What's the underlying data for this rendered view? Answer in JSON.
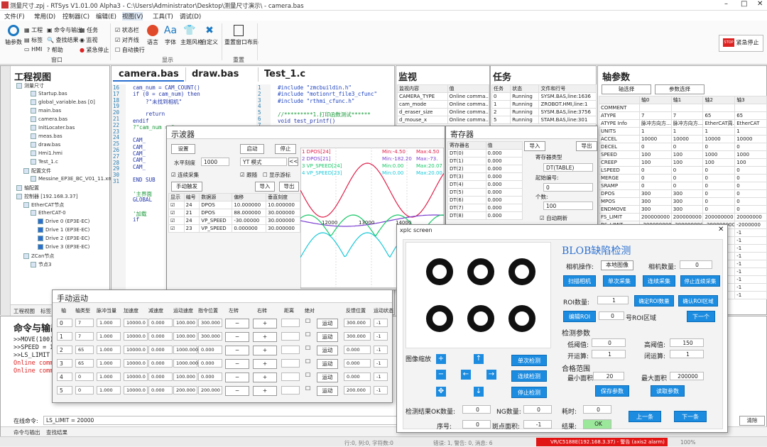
{
  "app": {
    "title": "测量尺寸.zpj - RTSys V1.01.00 Alpha3 - C:\\Users\\Administrator\\Desktop\\测量尺寸演示\\ - camera.bas"
  },
  "menu": [
    "文件(F)",
    "常用(D)",
    "控制器(C)",
    "编辑(E)",
    "视图(V)",
    "工具(T)",
    "调试(D)"
  ],
  "ribbon": {
    "axis_param": "轴参数",
    "project": "工程",
    "label": "标签",
    "hmi": "HMI",
    "cmd_output": "命令与输出",
    "find_result": "查找结果",
    "help": "帮助",
    "task": "任务",
    "watch": "监视",
    "estop_small": "紧急停止",
    "status_bar": "状态栏",
    "align_bar": "对齐线",
    "auto_wrap": "自动换行",
    "language": "语言",
    "font": "字体",
    "theme": "主题风格",
    "custom": "自定义",
    "reset_layout": "重置窗口布局",
    "window_group": "窗口",
    "display_group": "显示",
    "reset_group": "重置",
    "estop": "紧急停止"
  },
  "project": {
    "title": "工程视图",
    "items": [
      "测量尺寸",
      "Startup.bas",
      "global_variable.bas [0]",
      "main.bas",
      "camera.bas",
      "InitLocater.bas",
      "meas.bas",
      "draw.bas",
      "Hmi1.hmi",
      "Test_1.c",
      "配置文件",
      "Messine_EP3E_BC_V01_11.xml",
      "轴配置",
      "控制器 [192.168.3.37]",
      "EtherCAT节点",
      "EtherCAT-0",
      "Drive 0 (EP3E-EC)",
      "Drive 1 (EP3E-EC)",
      "Drive 2 (EP3E-EC)",
      "Drive 3 (EP3E-EC)",
      "ZCan节点",
      "节点3"
    ],
    "tabs": [
      "工程视图",
      "标签"
    ]
  },
  "editors": [
    {
      "tab": "camera.bas",
      "lines": [
        "16",
        "17",
        "18",
        "19",
        "20",
        "21",
        "22",
        "23",
        "24",
        "25",
        "26",
        "27",
        "28",
        "29",
        "30",
        "31"
      ],
      "code": [
        "cam_num = CAM_COUNT()",
        "if (0 = cam_num) then",
        "    ?\"未找到相机\"",
        "",
        "    return",
        "endif",
        "?\"cam_num = \",cam_num",
        "",
        "CAM_",
        "CAM_",
        "CAM_",
        "CAM_",
        "CAM_",
        "",
        "END SUB",
        "",
        "'主界面",
        "GLOBAL",
        "",
        "'加载",
        "if"
      ]
    },
    {
      "tab": "draw.bas"
    },
    {
      "tab": "Test_1.c",
      "lines": [
        "1",
        "2",
        "3",
        "4",
        "5",
        "6",
        "7",
        "8"
      ],
      "code": [
        "#include \"zmcbuildin.h\"",
        "#include \"motionrt_file3_cfunc\"",
        "#include \"rthmi_cfunc.h\"",
        "",
        "//*********1.打印函数测试******",
        "void test_printf()"
      ]
    }
  ],
  "watch": {
    "title": "监视",
    "cols": [
      "监视内容",
      "值"
    ],
    "rows": [
      [
        "CAMERA_TYPE",
        "Online comma..."
      ],
      [
        "cam_mode",
        "Online comma..."
      ],
      [
        "d_eraser_size",
        "Online comma..."
      ],
      [
        "d_mouse_x",
        "Online comma..."
      ]
    ]
  },
  "task": {
    "title": "任务",
    "cols": [
      "任务",
      "状态",
      "文件和行号"
    ],
    "rows": [
      [
        "0",
        "Running",
        "SYSM.BAS,line:1636"
      ],
      [
        "1",
        "Running",
        "ZROBOT.HMI,line:1"
      ],
      [
        "2",
        "Running",
        "SYSM.BAS,line:3756"
      ],
      [
        "5",
        "Running",
        "STAM.BAS,line:301"
      ]
    ]
  },
  "axis": {
    "title": "轴参数",
    "select": "轴选择",
    "param_select": "参数选择",
    "cols": [
      "",
      "轴0",
      "轴1",
      "轴2",
      "轴3"
    ],
    "rows": [
      [
        "COMMENT",
        "",
        "",
        "",
        ""
      ],
      [
        "ATYPE",
        "7",
        "7",
        "65",
        "65"
      ],
      [
        "ATYPE Info",
        "脉冲方向方...",
        "脉冲方向方...",
        "EtherCAT周...",
        "EtherCAT"
      ],
      [
        "UNITS",
        "1",
        "1",
        "1",
        "1"
      ],
      [
        "ACCEL",
        "10000",
        "10000",
        "10000",
        "10000"
      ],
      [
        "DECEL",
        "0",
        "0",
        "0",
        "0"
      ],
      [
        "SPEED",
        "100",
        "100",
        "1000",
        "1000"
      ],
      [
        "CREEP",
        "100",
        "100",
        "100",
        "100"
      ],
      [
        "LSPEED",
        "0",
        "0",
        "0",
        "0"
      ],
      [
        "MERGE",
        "0",
        "0",
        "0",
        "0"
      ],
      [
        "SRAMP",
        "0",
        "0",
        "0",
        "0"
      ],
      [
        "DPOS",
        "300",
        "300",
        "0",
        "0"
      ],
      [
        "MPOS",
        "300",
        "300",
        "0",
        "0"
      ],
      [
        "ENDMOVE",
        "300",
        "300",
        "0",
        "0"
      ],
      [
        "FS_LIMIT",
        "200000000",
        "200000000",
        "200000000",
        "20000000"
      ],
      [
        "RS_LIMIT",
        "-200000000",
        "-200000000",
        "-200000000",
        "-2000000"
      ],
      [
        "",
        "0",
        "0",
        "0",
        "-1"
      ],
      [
        "",
        "0",
        "0",
        "0",
        "-1"
      ],
      [
        "",
        "0",
        "0",
        "0",
        "-1"
      ],
      [
        "",
        "0",
        "0",
        "0",
        "-1"
      ],
      [
        "",
        "0",
        "0",
        "0",
        "-1"
      ],
      [
        "",
        "0",
        "0",
        "0",
        "-1"
      ],
      [
        "",
        "0",
        "0",
        "0",
        "-1"
      ],
      [
        "",
        "0",
        "0",
        "0",
        "-1"
      ],
      [
        "",
        "0 0 0",
        "0 0 0",
        "0",
        "-1"
      ]
    ]
  },
  "scope": {
    "title": "示波器",
    "settings": "设置",
    "start": "启动",
    "stop": "停止",
    "hscale_label": "水平刻度",
    "hscale": "1000",
    "mode": "YT 模式",
    "continuous": "连续采集",
    "follow": "跟随",
    "show_cursor": "显示游标",
    "manual_trigger": "手动触发",
    "import": "导入",
    "export": "导出",
    "cols": [
      "显示",
      "编号",
      "数据源",
      "偏移",
      "垂直刻度"
    ],
    "rows": [
      [
        "24",
        "DPOS",
        "10.000000",
        "10.000000"
      ],
      [
        "21",
        "DPOS",
        "88.000000",
        "30.000000"
      ],
      [
        "24",
        "VP_SPEED",
        "-30.00000",
        "30.000000"
      ],
      [
        "23",
        "VP_SPEED",
        "0.000000",
        "30.000000"
      ]
    ],
    "legend": [
      "1 DPOS[24]",
      "2 DPOS[21]",
      "3 VP_SPEED[24]",
      "4 VP_SPEED[23]"
    ],
    "mins": [
      "Min:-4.50",
      "Min:-182.20",
      "Min:0.00",
      "Min:0.00"
    ],
    "maxs": [
      "Max:4.50",
      "Max:-73.",
      "Max:20.07",
      "Max:20.00"
    ],
    "xticks": [
      "12000",
      "13000",
      "14000"
    ],
    "colors": [
      "#e0204a",
      "#7a3fd0",
      "#18c868",
      "#18c8d8"
    ]
  },
  "reg": {
    "title": "寄存器",
    "cols": [
      "寄存器名",
      "值"
    ],
    "rows": [
      [
        "DT(0)",
        "0.000"
      ],
      [
        "DT(1)",
        "0.000"
      ],
      [
        "DT(2)",
        "0.000"
      ],
      [
        "DT(3)",
        "0.000"
      ],
      [
        "DT(4)",
        "0.000"
      ],
      [
        "DT(5)",
        "0.000"
      ],
      [
        "DT(6)",
        "0.000"
      ],
      [
        "DT(7)",
        "0.000"
      ],
      [
        "DT(8)",
        "0.000"
      ]
    ],
    "import": "导入",
    "export": "导出",
    "type_label": "寄存器类型",
    "type": "DT(TABLE)",
    "start_label": "起始编号:",
    "start": "0",
    "count_label": "个数:",
    "count": "100",
    "auto_refresh": "自动刷新"
  },
  "manual": {
    "title": "手动运动",
    "cols": [
      "轴",
      "轴类型",
      "脉冲当量",
      "加速度",
      "减速度",
      "运动速度",
      "指令位置",
      "左转",
      "右转",
      "距离",
      "绝对",
      "",
      "反馈位置",
      "运动状态"
    ],
    "rows": [
      [
        "0",
        "7",
        "1.000",
        "10000.0",
        "0.000",
        "100.000",
        "300.000",
        "300.000",
        "-1"
      ],
      [
        "1",
        "7",
        "1.000",
        "10000.0",
        "0.000",
        "100.000",
        "300.000",
        "300.000",
        "-1"
      ],
      [
        "2",
        "65",
        "1.000",
        "10000.0",
        "0.000",
        "1000.000",
        "0.000",
        "0.000",
        "-1"
      ],
      [
        "3",
        "65",
        "1.000",
        "10000.0",
        "0.000",
        "1000.000",
        "0.000",
        "0.000",
        "-1"
      ],
      [
        "4",
        "0",
        "1.000",
        "10000.0",
        "0.000",
        "100.000",
        "0.000",
        "0.000",
        "-1"
      ],
      [
        "5",
        "0",
        "1.000",
        "10000.0",
        "0.000",
        "200.000",
        "200.000",
        "200.000",
        "-1"
      ]
    ],
    "move": "运动"
  },
  "cmd": {
    "title": "命令与输出",
    "lines": [
      ">>MOVE(100)",
      ">>SPEED = 10",
      ">>LS_LIMIT =",
      "Online comma",
      "Online comma"
    ],
    "input_label": "在线命令:",
    "input": "LS_LIMIT = 20000",
    "tabs": [
      "命令与输出",
      "查找结果"
    ],
    "clear": "清除"
  },
  "xplc": {
    "title": "xplc screen",
    "blob": "BLOB缺陷检测",
    "cam_op": "相机操作:",
    "local_img": "本地图像",
    "cam_count": "相机数量:",
    "cam_count_v": "0",
    "scan": "扫描相机",
    "single": "单次采集",
    "cont": "连续采集",
    "stop_cont": "停止连续采集",
    "roi_count": "ROI数量:",
    "roi_v": "1",
    "confirm_roi": "确定ROI数量",
    "confirm_roi2": "确认ROI区域",
    "edit_roi": "编辑ROI",
    "roi_area": "号ROI区域",
    "roi_idx": "0",
    "next": "下一个",
    "det_param": "检测参数",
    "low_th": "低阈值:",
    "low_v": "0",
    "high_th": "高阈值:",
    "high_v": "150",
    "open": "开运算:",
    "open_v": "1",
    "close": "闭运算:",
    "close_v": "1",
    "qual": "合格范围",
    "min_area": "最小面积",
    "min_v": "20",
    "max_area": "最大面积",
    "max_v": "200000",
    "save": "保存参数",
    "read": "读取参数",
    "zoom": "图像缩放",
    "single_det": "单次检测",
    "cont_det": "连续检测",
    "stop_det": "停止检测",
    "ok_count": "检测结果OK数量:",
    "ok_v": "0",
    "ng_count": "NG数量:",
    "ng_v": "0",
    "time": "耗时:",
    "time_v": "0",
    "seq": "序号:",
    "seq_v": "0",
    "spot_area": "斑点面积:",
    "spot_v": "-1",
    "result": "结果:",
    "result_v": "OK",
    "prev": "上一条",
    "nxt": "下一条"
  },
  "status": {
    "pos": "行:0, 列:0, 字符数:0",
    "err": "错误: 1, 警告: 0, 消息: 6",
    "ctrl": "VR/C5188E(192.168.3.37) - 警告 (axis2 alarm)",
    "zoom": "100%"
  }
}
